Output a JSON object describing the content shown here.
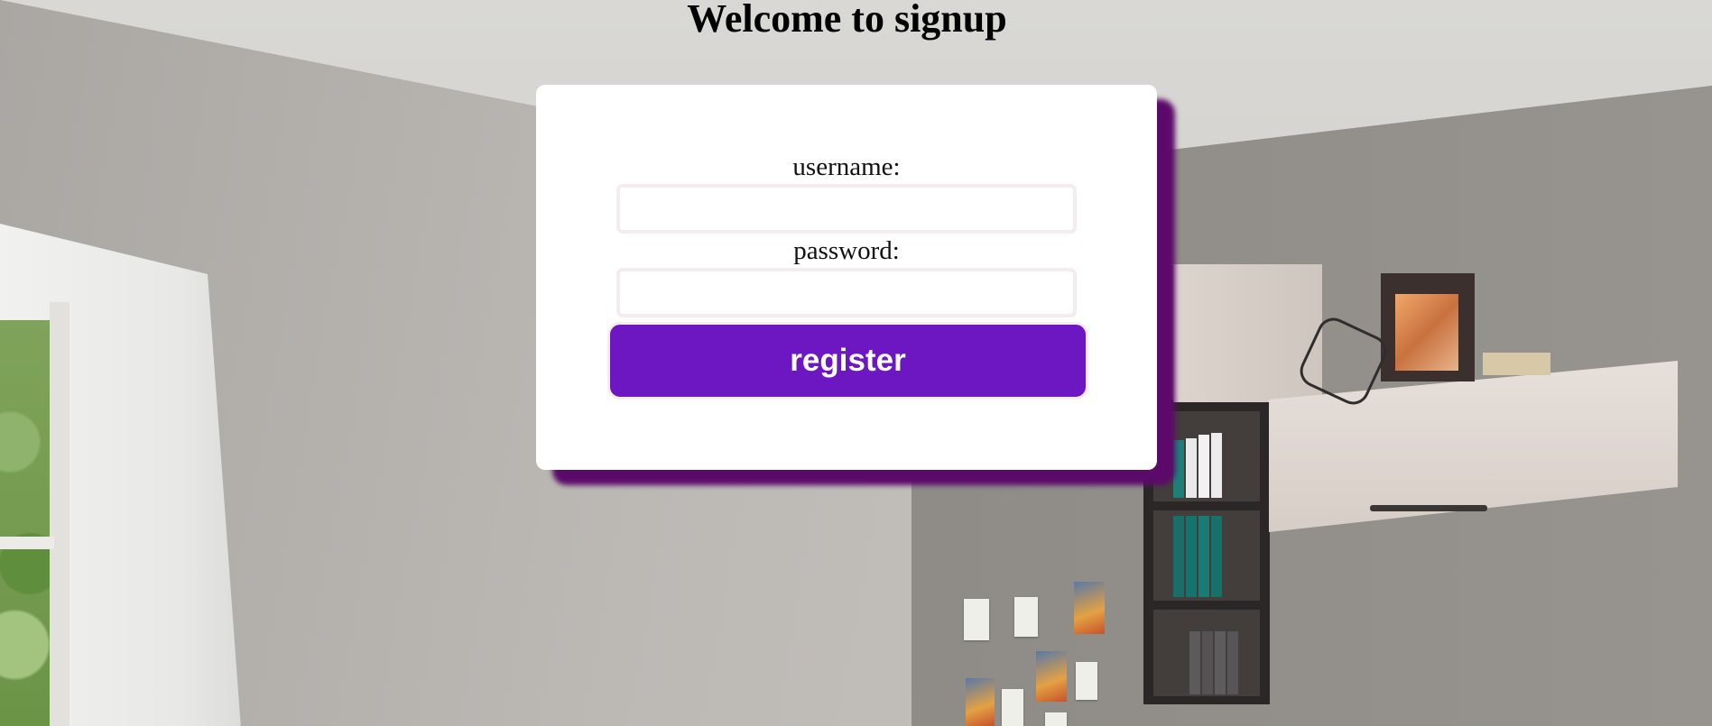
{
  "page": {
    "title": "Welcome to signup"
  },
  "form": {
    "username_label": "username:",
    "username_value": "",
    "password_label": "password:",
    "password_value": "",
    "submit_label": "register"
  },
  "colors": {
    "button_background": "#6c17c2",
    "card_shadow": "#5b0a6a",
    "card_background": "#ffffff",
    "input_border": "#f4ecef"
  }
}
